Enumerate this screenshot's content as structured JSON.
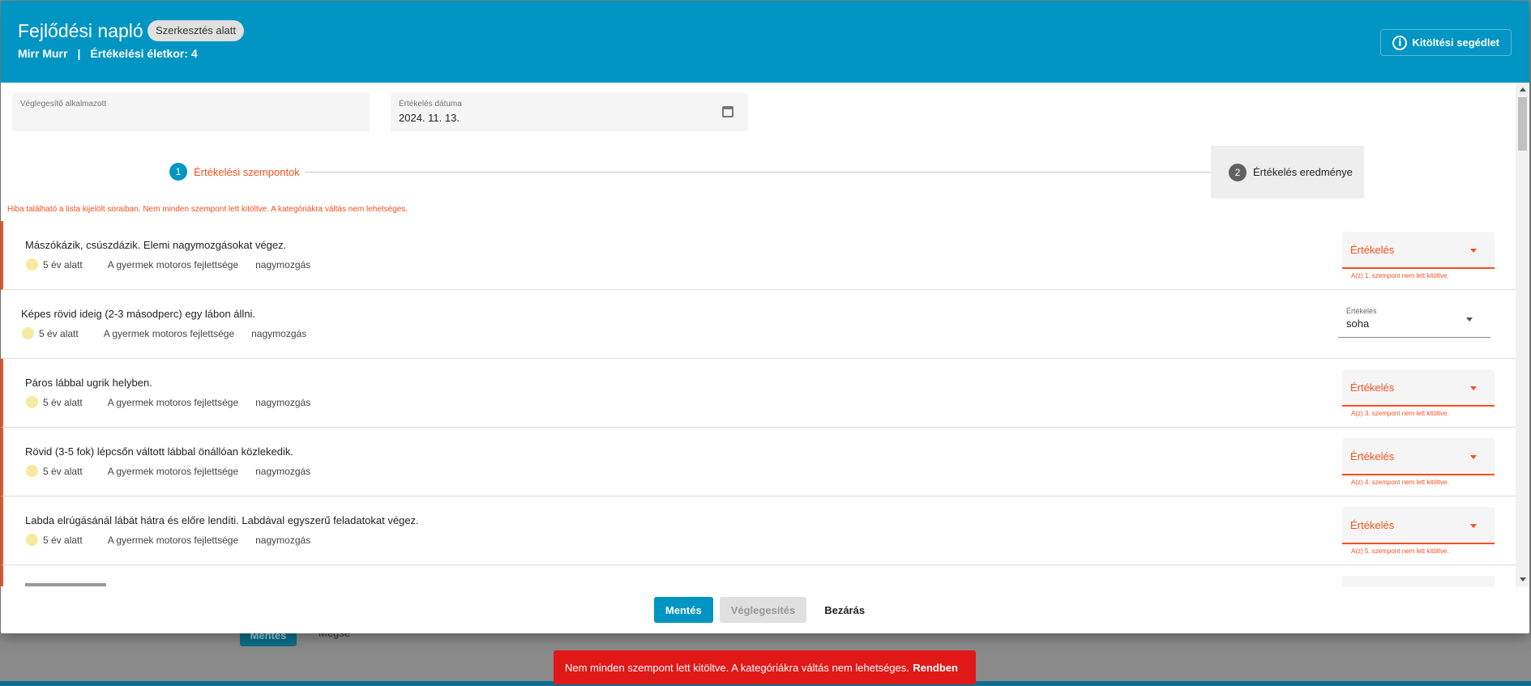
{
  "header": {
    "title": "Fejlődési napló",
    "status_chip": "Szerkesztés alatt",
    "child_name": "Mirr Murr",
    "separator": "|",
    "age_label": "Értékelési életkor: 4",
    "help_button": "Kitöltési segédlet"
  },
  "fields": {
    "employee_label": "Véglegesítő alkalmazott",
    "employee_value": "",
    "date_label": "Értékelés dátuma",
    "date_value": "2024. 11. 13."
  },
  "stepper": {
    "step1_num": "1",
    "step1_label": "Értékelési szempontok",
    "step2_num": "2",
    "step2_label": "Értékelés eredménye"
  },
  "error_message": "Hiba található a lista kijelölt soraiban. Nem minden szempont lett kitöltve. A kategóriákra váltás nem lehetséges.",
  "rows": [
    {
      "title": "Mászókázik, csúszdázik. Elemi nagymozgásokat végez.",
      "age": "5 év alatt",
      "category": "A gyermek motoros fejlettsége",
      "sub": "nagymozgás",
      "select_placeholder": "Értékelés",
      "hint": "A(z) 1. szempont nem lett kitöltve."
    },
    {
      "title": "Képes rövid ideig (2-3 másodperc) egy lábon állni.",
      "age": "5 év alatt",
      "category": "A gyermek motoros fejlettsége",
      "sub": "nagymozgás",
      "select_label": "Értékelés",
      "select_value": "soha"
    },
    {
      "title": "Páros lábbal ugrik helyben.",
      "age": "5 év alatt",
      "category": "A gyermek motoros fejlettsége",
      "sub": "nagymozgás",
      "select_placeholder": "Értékelés",
      "hint": "A(z) 3. szempont nem lett kitöltve."
    },
    {
      "title": "Rövid (3-5 fok) lépcsőn váltott lábbal önállóan közlekedik.",
      "age": "5 év alatt",
      "category": "A gyermek motoros fejlettsége",
      "sub": "nagymozgás",
      "select_placeholder": "Értékelés",
      "hint": "A(z) 4. szempont nem lett kitöltve."
    },
    {
      "title": "Labda elrúgásánál lábát hátra és előre lendíti. Labdával egyszerű feladatokat végez.",
      "age": "5 év alatt",
      "category": "A gyermek motoros fejlettsége",
      "sub": "nagymozgás",
      "select_placeholder": "Értékelés",
      "hint": "A(z) 5. szempont nem lett kitöltve."
    }
  ],
  "footer": {
    "save": "Mentés",
    "finalize": "Véglegesítés",
    "close": "Bezárás"
  },
  "background": {
    "save": "Mentés",
    "cancel": "Mégse"
  },
  "snackbar": {
    "message": "Nem minden szempont lett kitöltve. A kategóriákra váltás nem lehetséges.",
    "action": "Rendben"
  },
  "colors": {
    "primary": "#0095c2",
    "error": "#f4511e",
    "snackbar": "#e01818"
  }
}
